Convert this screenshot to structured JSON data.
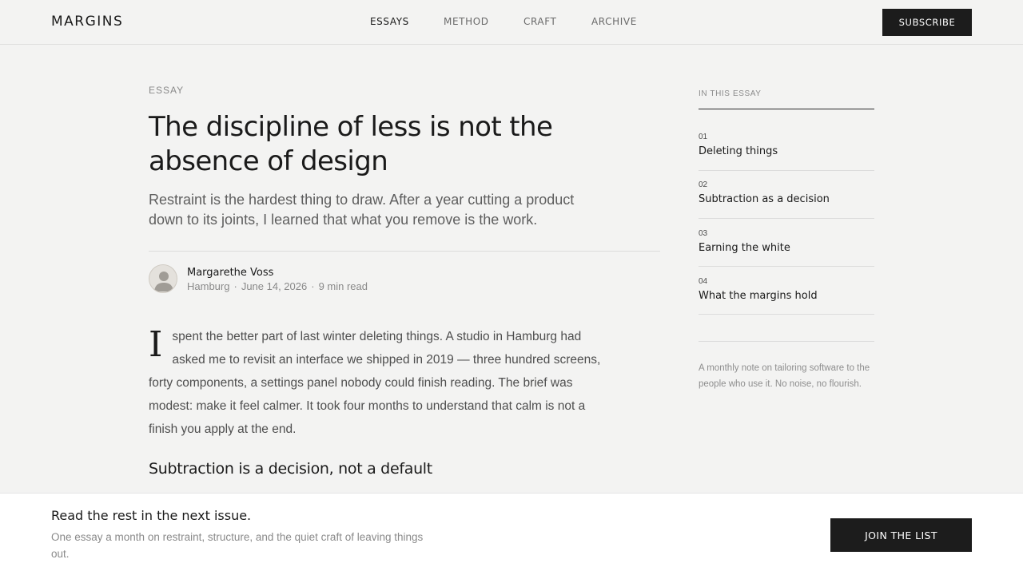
{
  "header": {
    "logo": "MARGINS",
    "nav": [
      {
        "label": "ESSAYS",
        "active": true
      },
      {
        "label": "METHOD",
        "active": false
      },
      {
        "label": "CRAFT",
        "active": false
      },
      {
        "label": "ARCHIVE",
        "active": false
      }
    ],
    "subscribe_label": "SUBSCRIBE"
  },
  "article": {
    "kicker": "ESSAY",
    "title": "The discipline of less is not the absence of design",
    "dek": "Restraint is the hardest thing to draw. After a year cutting a product down to its joints, I learned that what you remove is the work.",
    "author": {
      "name": "Margarethe Voss",
      "location": "Hamburg",
      "date": "June 14, 2026",
      "read_time": "9 min read",
      "avatar_icon": "person-icon"
    },
    "separator": "·",
    "dropcap": "I",
    "body": "spent the better part of last winter deleting things. A studio in Hamburg had asked me to revisit an interface we shipped in 2019 — three hundred screens, forty components, a settings panel nobody could finish reading. The brief was modest: make it feel calmer. It took four months to understand that calm is not a finish you apply at the end.",
    "subhead": "Subtraction is a decision, not a default"
  },
  "toc": {
    "heading": "IN THIS ESSAY",
    "items": [
      {
        "num": "01",
        "label": "Deleting things"
      },
      {
        "num": "02",
        "label": "Subtraction as a decision"
      },
      {
        "num": "03",
        "label": "Earning the white"
      },
      {
        "num": "04",
        "label": "What the margins hold"
      }
    ],
    "note": "A monthly note on tailoring software to the people who use it. No noise, no flourish."
  },
  "banner": {
    "title": "Read the rest in the next issue.",
    "text": "One essay a month on restraint, structure, and the quiet craft of leaving things out.",
    "button_label": "JOIN THE LIST"
  },
  "colors": {
    "background": "#f3f3f2",
    "ink": "#1a1a1a",
    "button": "#1c1c1c",
    "muted": "#8a8a8a"
  }
}
